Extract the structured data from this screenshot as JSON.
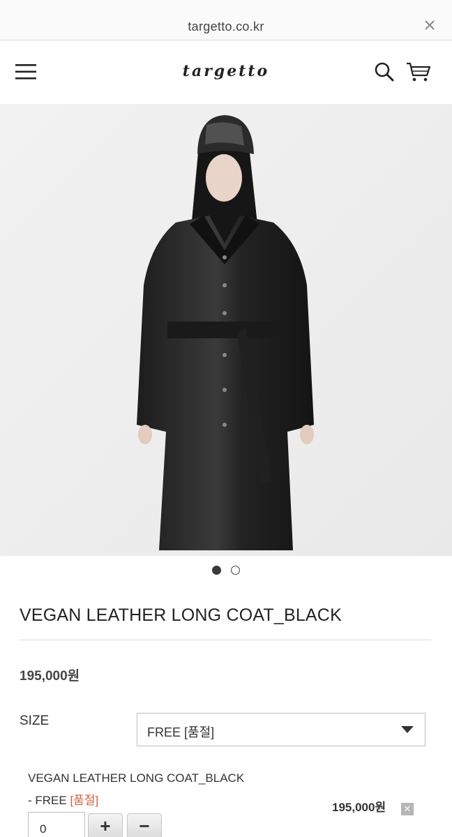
{
  "browser": {
    "url": "targetto.co.kr",
    "close_icon": "close-icon"
  },
  "header": {
    "logo": "targetto",
    "menu_icon": "hamburger-menu-icon",
    "search_icon": "search-icon",
    "cart_icon": "cart-icon"
  },
  "gallery": {
    "image": "model-wearing-black-leather-coat",
    "slide_count": 2,
    "active_slide": 1
  },
  "product": {
    "title": "VEGAN LEATHER LONG COAT_BLACK",
    "price": "195,000원"
  },
  "options": {
    "size_label": "SIZE",
    "size_selected": "FREE [품절]"
  },
  "selected_item": {
    "name": "VEGAN LEATHER LONG COAT_BLACK",
    "variant_prefix": "- FREE ",
    "variant_status": "[품절]",
    "price": "195,000원",
    "quantity": "0",
    "plus_label": "+",
    "minus_label": "−",
    "remove_label": "✕"
  },
  "colors": {
    "soldout": "#d0603a",
    "accent_dark": "#222222"
  }
}
